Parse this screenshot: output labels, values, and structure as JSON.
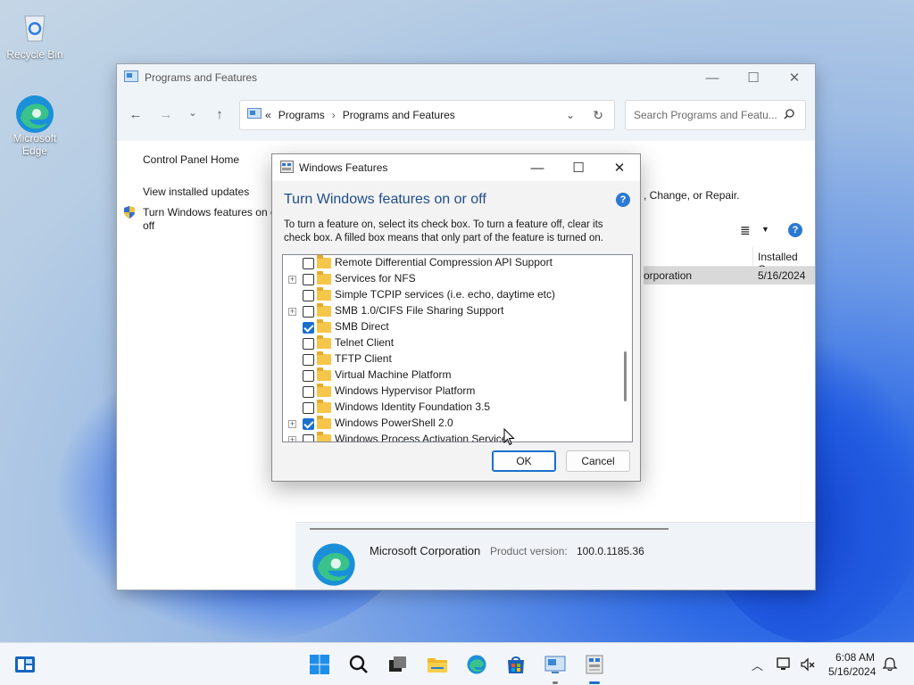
{
  "desktop": {
    "icons": [
      {
        "label": "Recycle Bin"
      },
      {
        "label": "Microsoft Edge"
      }
    ]
  },
  "window": {
    "title": "Programs and Features",
    "address": {
      "chevron": "«",
      "crumb1": "Programs",
      "crumb2": "Programs and Features"
    },
    "search_placeholder": "Search Programs and Featu...",
    "left_nav": {
      "home": "Control Panel Home",
      "updates": "View installed updates",
      "features_line1": "Turn Windows features on o",
      "features_line2": "off"
    },
    "body_fragment": ", Change, or Repair.",
    "column_installed_on": "Installed On",
    "row_publisher_fragment": "orporation",
    "row_date": "5/16/2024",
    "details": {
      "publisher": "Microsoft Corporation",
      "product_version_label": "Product version:",
      "product_version": "100.0.1185.36"
    }
  },
  "dialog": {
    "title": "Windows Features",
    "heading": "Turn Windows features on or off",
    "description": "To turn a feature on, select its check box. To turn a feature off, clear its check box. A filled box means that only part of the feature is turned on.",
    "features": [
      {
        "label": "Remote Differential Compression API Support",
        "checked": false,
        "expandable": false
      },
      {
        "label": "Services for NFS",
        "checked": false,
        "expandable": true
      },
      {
        "label": "Simple TCPIP services (i.e. echo, daytime etc)",
        "checked": false,
        "expandable": false
      },
      {
        "label": "SMB 1.0/CIFS File Sharing Support",
        "checked": false,
        "expandable": true
      },
      {
        "label": "SMB Direct",
        "checked": true,
        "expandable": false
      },
      {
        "label": "Telnet Client",
        "checked": false,
        "expandable": false
      },
      {
        "label": "TFTP Client",
        "checked": false,
        "expandable": false
      },
      {
        "label": "Virtual Machine Platform",
        "checked": false,
        "expandable": false
      },
      {
        "label": "Windows Hypervisor Platform",
        "checked": false,
        "expandable": false
      },
      {
        "label": "Windows Identity Foundation 3.5",
        "checked": false,
        "expandable": false
      },
      {
        "label": "Windows PowerShell 2.0",
        "checked": true,
        "expandable": true
      },
      {
        "label": "Windows Process Activation Service",
        "checked": false,
        "expandable": true
      }
    ],
    "ok_label": "OK",
    "cancel_label": "Cancel"
  },
  "taskbar": {
    "time": "6:08 AM",
    "date": "5/16/2024"
  },
  "colors": {
    "accent": "#1a6fce",
    "heading": "#1f4e8a",
    "folder": "#f6c64a"
  }
}
